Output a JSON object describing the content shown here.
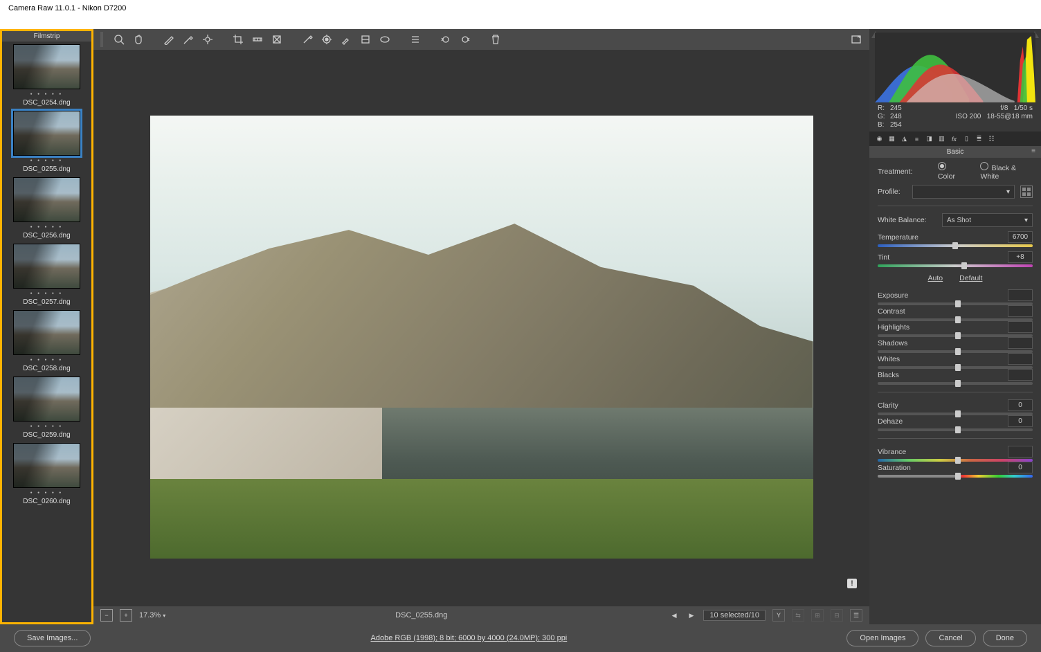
{
  "window": {
    "title": "Camera Raw 11.0.1  -  Nikon D7200"
  },
  "filmstrip": {
    "label": "Filmstrip",
    "items": [
      {
        "name": "DSC_0254.dng"
      },
      {
        "name": "DSC_0255.dng",
        "selected": true
      },
      {
        "name": "DSC_0256.dng"
      },
      {
        "name": "DSC_0257.dng"
      },
      {
        "name": "DSC_0258.dng"
      },
      {
        "name": "DSC_0259.dng"
      },
      {
        "name": "DSC_0260.dng"
      }
    ]
  },
  "statusbar": {
    "zoom": "17.3%",
    "filename": "DSC_0255.dng",
    "selection": "10 selected/10"
  },
  "footer": {
    "save_label": "Save Images...",
    "workflow": "Adobe RGB (1998); 8 bit; 6000 by 4000 (24.0MP); 300 ppi",
    "open": "Open Images",
    "cancel": "Cancel",
    "done": "Done"
  },
  "readout": {
    "R_label": "R:",
    "R": "245",
    "G_label": "G:",
    "G": "248",
    "B_label": "B:",
    "B": "254",
    "aperture": "f/8",
    "shutter": "1/50 s",
    "iso": "ISO 200",
    "lens": "18-55@18 mm"
  },
  "panel_head": "Basic",
  "treatment": {
    "label": "Treatment:",
    "color": "Color",
    "bw": "Black & White"
  },
  "profile": {
    "label": "Profile:",
    "value": ""
  },
  "wb": {
    "label": "White Balance:",
    "value": "As Shot"
  },
  "temperature": {
    "label": "Temperature",
    "value": "6700"
  },
  "tint": {
    "label": "Tint",
    "value": "+8"
  },
  "auto": "Auto",
  "default": "Default",
  "sliders": {
    "exposure": {
      "label": "Exposure",
      "value": ""
    },
    "contrast": {
      "label": "Contrast",
      "value": ""
    },
    "highlights": {
      "label": "Highlights",
      "value": ""
    },
    "shadows": {
      "label": "Shadows",
      "value": ""
    },
    "whites": {
      "label": "Whites",
      "value": ""
    },
    "blacks": {
      "label": "Blacks",
      "value": ""
    },
    "clarity": {
      "label": "Clarity",
      "value": "0"
    },
    "dehaze": {
      "label": "Dehaze",
      "value": "0"
    },
    "vibrance": {
      "label": "Vibrance",
      "value": ""
    },
    "saturation": {
      "label": "Saturation",
      "value": "0"
    }
  }
}
